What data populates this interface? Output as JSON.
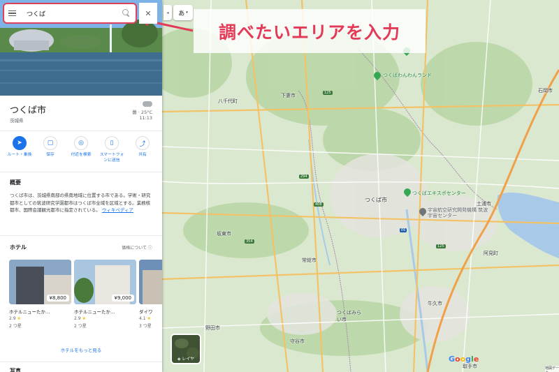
{
  "search": {
    "query": "つくば"
  },
  "topbar": {
    "lang_label": "あ",
    "collapse_glyph": "◂",
    "clear_glyph": "✕"
  },
  "place": {
    "name": "つくば市",
    "prefecture": "茨城県",
    "weather": "曇 · 25°C",
    "time": "11:13"
  },
  "actions": [
    {
      "label": "ルート・乗換",
      "icon": "directions-icon"
    },
    {
      "label": "保存",
      "icon": "bookmark-icon"
    },
    {
      "label": "付近を検索",
      "icon": "nearby-icon"
    },
    {
      "label": "スマートフォンに送信",
      "icon": "phone-icon"
    },
    {
      "label": "共有",
      "icon": "share-icon"
    }
  ],
  "action_glyphs": [
    "➤",
    "🔖",
    "◎",
    "▯",
    "⋈"
  ],
  "overview": {
    "heading": "概要",
    "text": "つくば市は、茨城県南部の県南地域に位置する市である。学術・研究都市としての筑波研究学園都市はつくば市全域を区域とする。業務核都市、国際会議観光都市に指定されている。",
    "link": "ウィキペディア"
  },
  "hotels": {
    "heading": "ホテル",
    "price_note": "価格について",
    "more_link": "ホテルをもっと見る",
    "items": [
      {
        "price": "¥8,800",
        "name": "ホテルニューたか…",
        "rating": "2.9",
        "class": "2 つ星"
      },
      {
        "price": "¥9,000",
        "name": "ホテルニューたか…",
        "rating": "2.9",
        "class": "2 つ星"
      },
      {
        "price": "",
        "name": "ダイワ",
        "rating": "4.1",
        "class": "3 つ星"
      }
    ]
  },
  "photos_heading": "写真",
  "callout": {
    "text": "調べたいエリアを入力",
    "color": "#e23a57"
  },
  "map": {
    "labels": [
      "つくばわんわんランド",
      "下妻市",
      "八千代町",
      "つくばエキスポセンター",
      "つくば市",
      "宇宙航空研究開発機構 筑波宇宙センター",
      "土浦市",
      "石岡市",
      "坂東市",
      "常総市",
      "つくばみらい市",
      "守谷市",
      "野田市",
      "牛久市",
      "阿見町",
      "取手市"
    ],
    "layer_label": "レイヤ",
    "google": "Google",
    "credit": "地図データ"
  },
  "colors": {
    "accent": "#1a73e8",
    "highlight": "#e0405b",
    "map_green": "#d7e6cc"
  }
}
